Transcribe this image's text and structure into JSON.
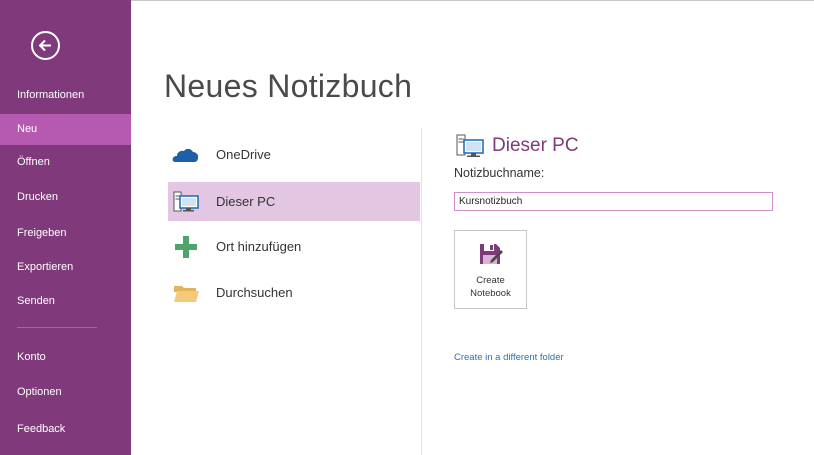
{
  "sidebar": {
    "back_icon": "back-arrow-icon",
    "items": [
      {
        "label": "Informationen"
      },
      {
        "label": "Neu"
      },
      {
        "label": "Öffnen"
      },
      {
        "label": "Drucken"
      },
      {
        "label": "Freigeben"
      },
      {
        "label": "Exportieren"
      },
      {
        "label": "Senden"
      },
      {
        "label": "Konto"
      },
      {
        "label": "Optionen"
      },
      {
        "label": "Feedback"
      }
    ],
    "selected": "Neu"
  },
  "main": {
    "title": "Neues Notizbuch",
    "locations": [
      {
        "label": "OneDrive",
        "icon": "cloud-icon"
      },
      {
        "label": "Dieser PC",
        "icon": "computer-icon"
      },
      {
        "label": "Ort hinzufügen",
        "icon": "plus-icon"
      },
      {
        "label": "Durchsuchen",
        "icon": "folder-icon"
      }
    ],
    "selected_location": "Dieser PC"
  },
  "right_panel": {
    "title": "Dieser PC",
    "notebook_name_label": "Notizbuchname:",
    "notebook_name_value": "Kursnotizbuch",
    "create_button_line1": "Create",
    "create_button_line2": "Notebook",
    "different_folder_link": "Create in a different folder"
  },
  "colors": {
    "sidebar": "#80397b",
    "sidebar_selected": "#b55ab0",
    "location_selected": "#e3c6e1",
    "accent": "#80397b",
    "link": "#2e6fb3"
  }
}
